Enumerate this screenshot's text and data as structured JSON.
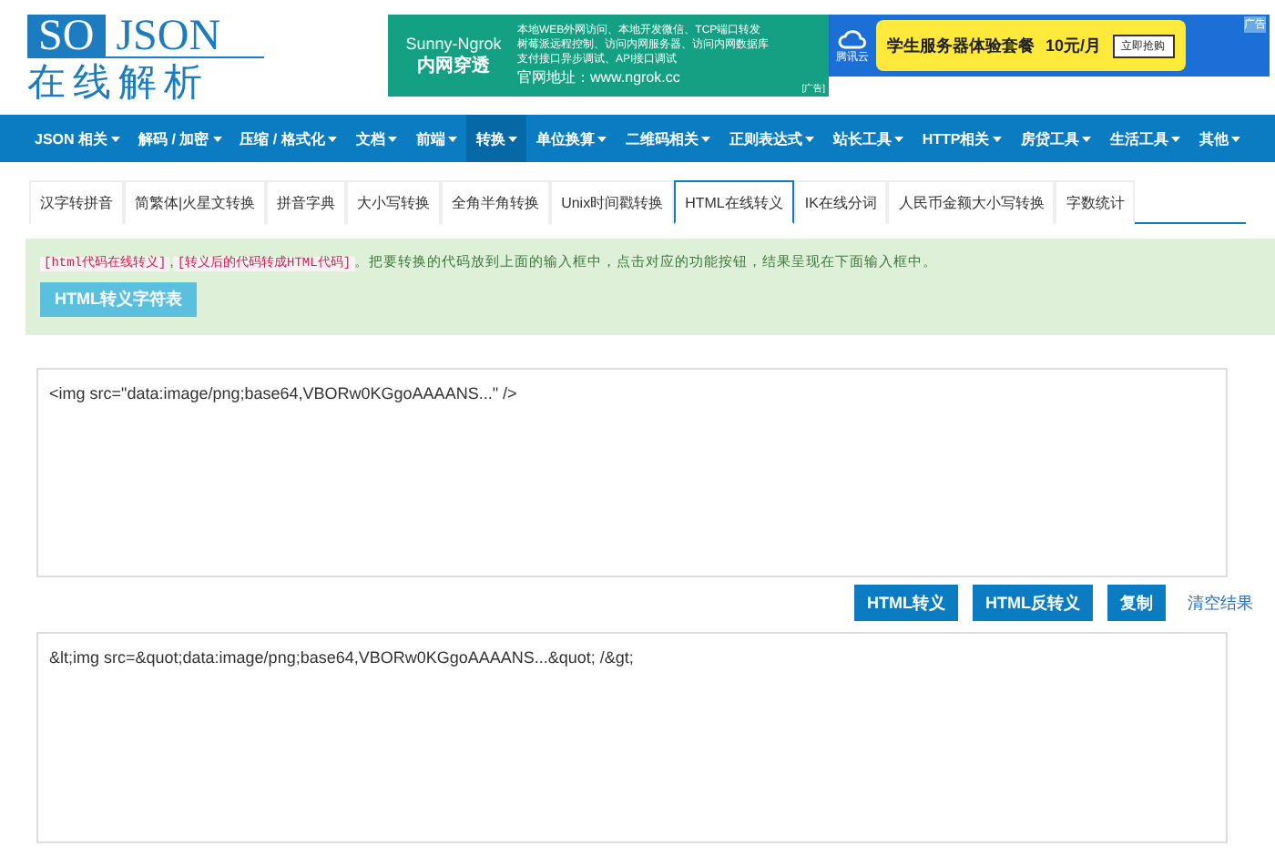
{
  "logo": {
    "top_left": "SO",
    "top_right": "JSON",
    "bottom": "在线解析"
  },
  "ads": [
    {
      "kind": "ngrok",
      "title": "Sunny-Ngrok",
      "subtitle": "内网穿透",
      "lines": [
        "本地WEB外网访问、本地开发微信、TCP端口转发",
        "树莓派远程控制、访问内网服务器、访问内网数据库",
        "支付接口异步调试、API接口调试"
      ],
      "url_line": "官网地址：www.ngrok.cc",
      "tag": "[广告]"
    },
    {
      "kind": "cloud",
      "brand": "腾讯云",
      "headline": "学生服务器体验套餐",
      "price": "10元/月",
      "cta": "立即抢购",
      "tag": "广告"
    }
  ],
  "nav": [
    {
      "label": "JSON 相关",
      "selected": false
    },
    {
      "label": "解码 / 加密",
      "selected": false
    },
    {
      "label": "压缩 / 格式化",
      "selected": false
    },
    {
      "label": "文档",
      "selected": false
    },
    {
      "label": "前端",
      "selected": false
    },
    {
      "label": "转换",
      "selected": true
    },
    {
      "label": "单位换算",
      "selected": false
    },
    {
      "label": "二维码相关",
      "selected": false
    },
    {
      "label": "正则表达式",
      "selected": false
    },
    {
      "label": "站长工具",
      "selected": false
    },
    {
      "label": "HTTP相关",
      "selected": false
    },
    {
      "label": "房贷工具",
      "selected": false
    },
    {
      "label": "生活工具",
      "selected": false
    },
    {
      "label": "其他",
      "selected": false
    }
  ],
  "tabs": [
    {
      "label": "汉字转拼音",
      "selected": false
    },
    {
      "label": "简繁体|火星文转换",
      "selected": false
    },
    {
      "label": "拼音字典",
      "selected": false
    },
    {
      "label": "大小写转换",
      "selected": false
    },
    {
      "label": "全角半角转换",
      "selected": false
    },
    {
      "label": "Unix时间戳转换",
      "selected": false
    },
    {
      "label": "HTML在线转义",
      "selected": true
    },
    {
      "label": "IK在线分词",
      "selected": false
    },
    {
      "label": "人民币金额大小写转换",
      "selected": false
    },
    {
      "label": "字数统计",
      "selected": false
    }
  ],
  "notice": {
    "codes": [
      "[html代码在线转义]",
      "[转义后的代码转成HTML代码]"
    ],
    "separator": ",",
    "text": "。把要转换的代码放到上面的输入框中，点击对应的功能按钮，结果呈现在下面输入框中。",
    "button": "HTML转义字符表"
  },
  "input": {
    "value": "<img src=\"data:image/png;base64,VBORw0KGgoAAAANS...\" />"
  },
  "actions": [
    {
      "kind": "button",
      "label": "HTML转义"
    },
    {
      "kind": "button",
      "label": "HTML反转义"
    },
    {
      "kind": "button",
      "label": "复制"
    },
    {
      "kind": "link",
      "label": "清空结果"
    }
  ],
  "output": {
    "value": "&lt;img src=&quot;data:image/png;base64,VBORw0KGgoAAAANS...&quot; /&gt;"
  }
}
